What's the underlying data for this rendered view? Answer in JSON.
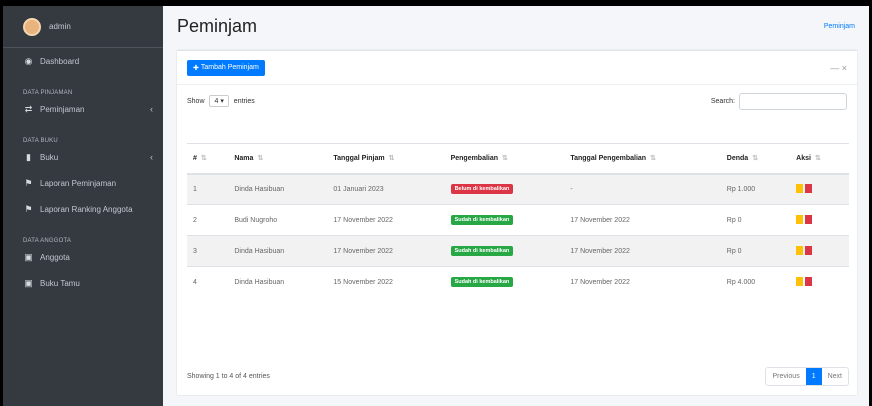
{
  "sidebar": {
    "user": "admin",
    "items": [
      {
        "type": "item",
        "icon": "tachometer-icon",
        "glyph": "◉",
        "label": "Dashboard"
      },
      {
        "type": "header",
        "label": "DATA PINJAMAN"
      },
      {
        "type": "item",
        "icon": "exchange-icon",
        "glyph": "⇄",
        "label": "Peminjaman",
        "chevron": "‹"
      },
      {
        "type": "header",
        "label": "DATA BUKU"
      },
      {
        "type": "item",
        "icon": "book-icon",
        "glyph": "▮",
        "label": "Buku",
        "chevron": "‹"
      },
      {
        "type": "item",
        "icon": "flag-icon",
        "glyph": "⚑",
        "label": "Laporan Peminjaman"
      },
      {
        "type": "item",
        "icon": "flag-icon",
        "glyph": "⚑",
        "label": "Laporan Ranking Anggota"
      },
      {
        "type": "header",
        "label": "DATA ANGGOTA"
      },
      {
        "type": "item",
        "icon": "id-card-icon",
        "glyph": "▣",
        "label": "Anggota"
      },
      {
        "type": "item",
        "icon": "id-card-icon",
        "glyph": "▣",
        "label": "Buku Tamu"
      }
    ]
  },
  "header": {
    "title": "Peminjam",
    "breadcrumb": "Peminjam"
  },
  "card": {
    "add_button": "Tambah Peminjam",
    "tools": "— ×"
  },
  "controls": {
    "show_label": "Show",
    "entries_value": "4",
    "entries_label": "entries",
    "search_label": "Search:",
    "search_value": ""
  },
  "table": {
    "columns": [
      "#",
      "Nama",
      "Tanggal Pinjam",
      "Pengembalian",
      "Tanggal Pengembalian",
      "Denda",
      "Aksi"
    ],
    "rows": [
      {
        "no": "1",
        "nama": "Dinda Hasibuan",
        "tgl_pinjam": "01 Januari 2023",
        "status": "Belum di kembalikan",
        "status_color": "#dc3545",
        "tgl_kembali": "-",
        "denda": "Rp 1.000"
      },
      {
        "no": "2",
        "nama": "Budi Nugroho",
        "tgl_pinjam": "17 November 2022",
        "status": "Sudah di kembalikan",
        "status_color": "#28a745",
        "tgl_kembali": "17 November 2022",
        "denda": "Rp 0"
      },
      {
        "no": "3",
        "nama": "Dinda Hasibuan",
        "tgl_pinjam": "17 November 2022",
        "status": "Sudah di kembalikan",
        "status_color": "#28a745",
        "tgl_kembali": "17 November 2022",
        "denda": "Rp 0"
      },
      {
        "no": "4",
        "nama": "Dinda Hasibuan",
        "tgl_pinjam": "15 November 2022",
        "status": "Sudah di kembalikan",
        "status_color": "#28a745",
        "tgl_kembali": "17 November 2022",
        "denda": "Rp 4.000"
      }
    ]
  },
  "footer": {
    "info": "Showing 1 to 4 of 4 entries",
    "prev": "Previous",
    "page": "1",
    "next": "Next"
  },
  "colors": {
    "sidebar": "#343a40",
    "primary": "#007bff",
    "danger": "#dc3545",
    "success": "#28a745",
    "warning": "#ffc107"
  }
}
